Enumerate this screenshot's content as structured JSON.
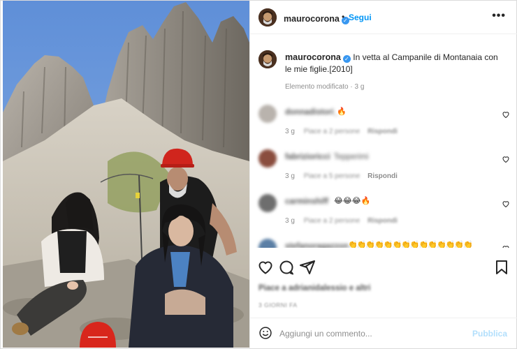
{
  "post": {
    "image_alt": "",
    "author": "maurocorona",
    "follow_label": "Segui",
    "separator": "•",
    "more_label": "•••"
  },
  "caption": {
    "username": "maurocorona",
    "text": "In vetta al Campanile di Montanaia con le mie figlie.[2010]",
    "meta": "Elemento modificato · 3 g"
  },
  "comments": [
    {
      "username": "donnadistori_",
      "text": "",
      "emoji": "🔥",
      "time": "3 g",
      "likes": "Piace a 2 persone",
      "reply": "Rispondi"
    },
    {
      "username": "fabrizioricci",
      "text": "Tepperimi",
      "emoji": "",
      "time": "3 g",
      "likes": "Piace a 5 persone",
      "reply": "Rispondi"
    },
    {
      "username": "carminshiff",
      "text": "",
      "emoji": "😂😂😂🔥",
      "time": "3 g",
      "likes": "Piace a 2 persone",
      "reply": "Rispondi"
    },
    {
      "username": "stefanoragazzon",
      "text": "",
      "emoji": "👏👏👏👏👏👏👏👏👏👏👏👏👏👏",
      "time": "",
      "likes": "",
      "reply": ""
    }
  ],
  "likes_text": "Piace a adrianidalessio e altri",
  "date_text": "3 GIORNI FA",
  "add_comment": {
    "placeholder": "Aggiungi un commento...",
    "publish_label": "Pubblica"
  },
  "colors": {
    "accent": "#0095f6",
    "verified": "#3897f0",
    "muted": "#8e8e8e",
    "publish_disabled": "#b2dffc"
  },
  "icons": [
    "verified-icon",
    "more-icon",
    "heart-icon",
    "comment-icon",
    "share-icon",
    "bookmark-icon",
    "emoji-icon"
  ]
}
